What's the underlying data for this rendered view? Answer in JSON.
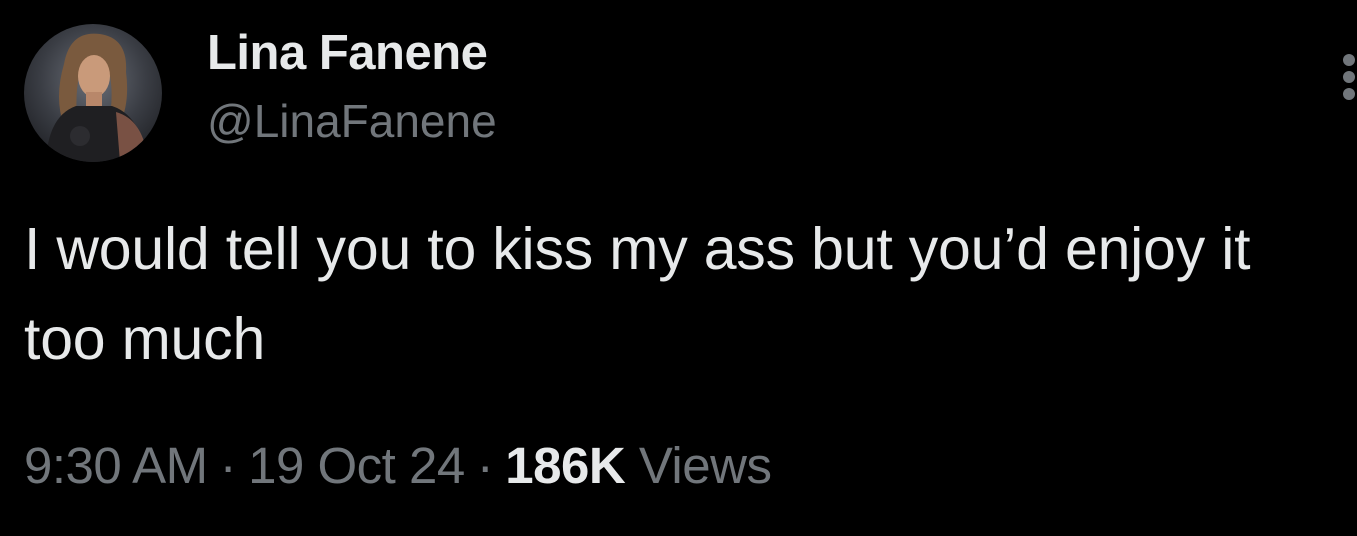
{
  "author": {
    "display_name": "Lina Fanene",
    "handle": "@LinaFanene"
  },
  "tweet": {
    "text": "I would tell you to kiss my ass but you’d enjoy it too much",
    "time": "9:30 AM",
    "separator": "·",
    "date": "19 Oct 24",
    "views_count": "186K",
    "views_label": "Views"
  },
  "icons": {
    "more": "more-vertical-icon"
  },
  "colors": {
    "background": "#000000",
    "primary_text": "#e7e9ea",
    "secondary_text": "#71767b"
  }
}
